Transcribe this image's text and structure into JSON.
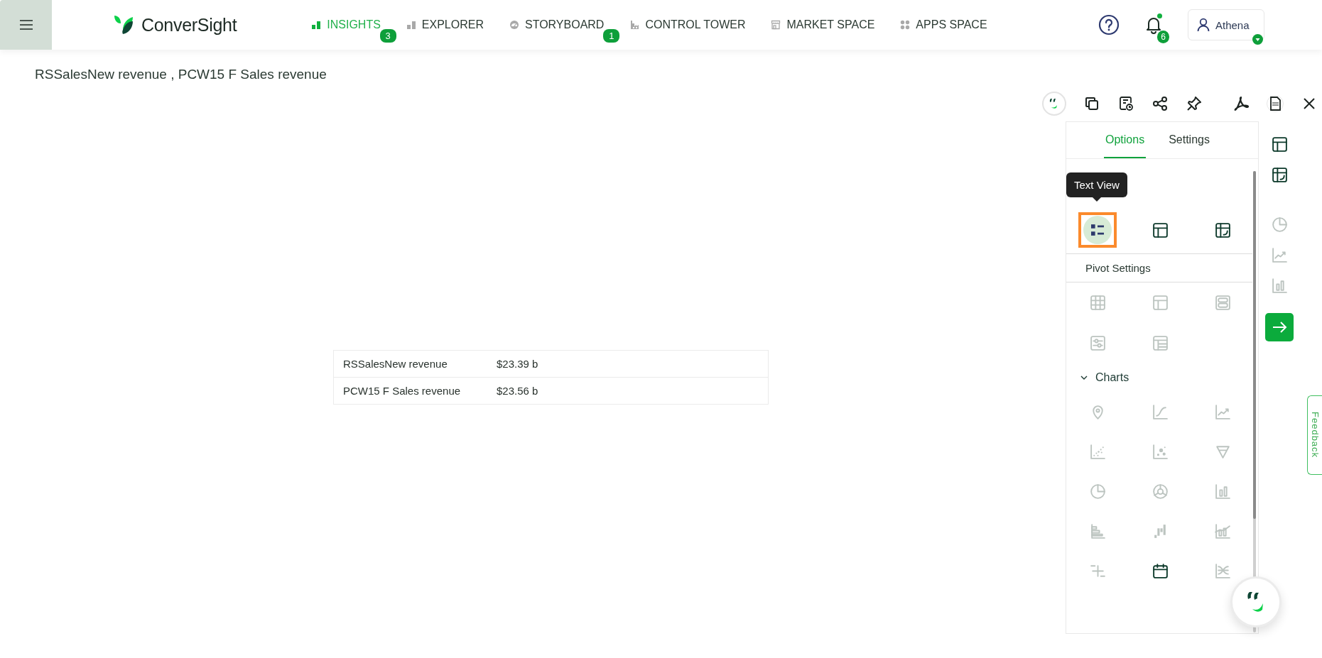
{
  "top_bar": {
    "brand": "ConverSight",
    "nav_items": [
      {
        "label": "INSIGHTS",
        "kind": "bars",
        "selected": true,
        "badge": "3"
      },
      {
        "label": "EXPLORER",
        "kind": "bars",
        "selected": false
      },
      {
        "label": "STORYBOARD",
        "kind": "gauge",
        "selected": false,
        "badge": "1"
      },
      {
        "label": "CONTROL TOWER",
        "kind": "tower",
        "selected": false
      },
      {
        "label": "MARKET SPACE",
        "kind": "store",
        "selected": false
      },
      {
        "label": "APPS SPACE",
        "kind": "dots",
        "selected": false
      }
    ],
    "notifications": {
      "count": "6",
      "unread": true
    },
    "user": {
      "name": "Athena"
    }
  },
  "page_title": "RSSalesNew revenue , PCW15 F Sales revenue",
  "results_table": {
    "rows": [
      {
        "label": "RSSalesNew revenue",
        "value": "$23.39 b"
      },
      {
        "label": "PCW15 F Sales revenue",
        "value": "$23.56 b"
      }
    ]
  },
  "options_panel": {
    "tabs": [
      {
        "label": "Options",
        "selected": true
      },
      {
        "label": "Settings",
        "selected": false
      }
    ],
    "tooltip": "Text View",
    "table_views": [
      {
        "kind": "text",
        "selected": true
      },
      {
        "kind": "table",
        "selected": false
      },
      {
        "kind": "pivot",
        "selected": false
      }
    ],
    "pivot_settings": "Pivot Settings",
    "pivot_options": [
      {
        "kind": "grid",
        "disabled": true
      },
      {
        "kind": "table",
        "disabled": true
      },
      {
        "kind": "rows",
        "disabled": true
      },
      {
        "kind": "sliders",
        "disabled": true
      },
      {
        "kind": "listtable",
        "disabled": true
      }
    ],
    "charts": {
      "title": "Charts",
      "expanded": true,
      "items": [
        {
          "kind": "map",
          "disabled": true
        },
        {
          "kind": "curve",
          "disabled": true
        },
        {
          "kind": "trend",
          "disabled": true
        },
        {
          "kind": "scatter",
          "disabled": true
        },
        {
          "kind": "bubble",
          "disabled": true
        },
        {
          "kind": "funnel",
          "disabled": true
        },
        {
          "kind": "pie",
          "disabled": true
        },
        {
          "kind": "donut",
          "disabled": true
        },
        {
          "kind": "column",
          "disabled": true
        },
        {
          "kind": "hbar",
          "disabled": true
        },
        {
          "kind": "waterfall",
          "disabled": true
        },
        {
          "kind": "combo",
          "disabled": true
        },
        {
          "kind": "plusminus",
          "disabled": true
        },
        {
          "kind": "calendar",
          "disabled": false
        },
        {
          "kind": "sankey",
          "disabled": true
        }
      ]
    }
  },
  "side_rail": [
    {
      "kind": "table",
      "disabled": false
    },
    {
      "kind": "pivot",
      "disabled": false
    },
    {
      "kind": "pie",
      "disabled": true
    },
    {
      "kind": "trend",
      "disabled": true
    },
    {
      "kind": "column",
      "disabled": true
    }
  ],
  "feedback": "Feedback"
}
